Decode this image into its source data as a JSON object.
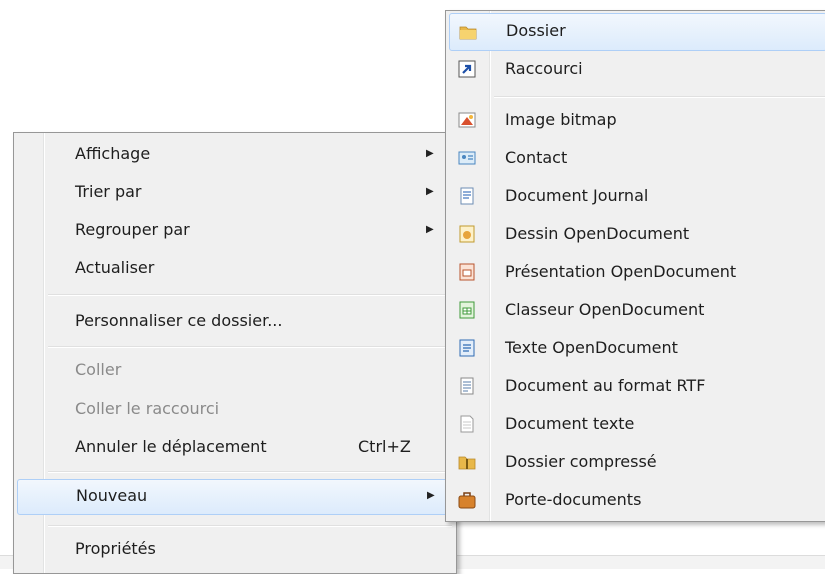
{
  "context_menu": {
    "items": [
      {
        "label": "Affichage",
        "has_submenu": true
      },
      {
        "label": "Trier par",
        "has_submenu": true
      },
      {
        "label": "Regrouper par",
        "has_submenu": true
      },
      {
        "label": "Actualiser"
      },
      {
        "label": "Personnaliser ce dossier..."
      },
      {
        "label": "Coller",
        "disabled": true
      },
      {
        "label": "Coller le raccourci",
        "disabled": true
      },
      {
        "label": "Annuler le déplacement",
        "shortcut": "Ctrl+Z"
      },
      {
        "label": "Nouveau",
        "has_submenu": true,
        "highlighted": true
      },
      {
        "label": "Propriétés"
      }
    ],
    "arrow_glyph": "▶"
  },
  "new_submenu": {
    "items": [
      {
        "label": "Dossier",
        "icon": "folder-icon",
        "highlighted": true
      },
      {
        "label": "Raccourci",
        "icon": "shortcut-icon"
      },
      {
        "label": "Image bitmap",
        "icon": "bitmap-image-icon"
      },
      {
        "label": "Contact",
        "icon": "contact-icon"
      },
      {
        "label": "Document Journal",
        "icon": "journal-document-icon"
      },
      {
        "label": "Dessin OpenDocument",
        "icon": "opendocument-drawing-icon"
      },
      {
        "label": "Présentation OpenDocument",
        "icon": "opendocument-presentation-icon"
      },
      {
        "label": "Classeur OpenDocument",
        "icon": "opendocument-spreadsheet-icon"
      },
      {
        "label": "Texte OpenDocument",
        "icon": "opendocument-text-icon"
      },
      {
        "label": "Document au format RTF",
        "icon": "rtf-document-icon"
      },
      {
        "label": "Document texte",
        "icon": "text-document-icon"
      },
      {
        "label": "Dossier compressé",
        "icon": "compressed-folder-icon"
      },
      {
        "label": "Porte-documents",
        "icon": "briefcase-icon"
      }
    ]
  },
  "colors": {
    "menu_background": "#f0f0f0",
    "highlight_border": "#aecff7",
    "disabled_text": "#8a8a8a"
  }
}
